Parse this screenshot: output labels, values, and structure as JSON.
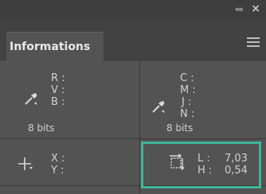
{
  "panel": {
    "collapse_glyph": "««",
    "close_glyph": "×",
    "tab_label": "Informations",
    "menu_icon": "menu-icon"
  },
  "left_color": {
    "r_label": "R :",
    "v_label": "V :",
    "b_label": "B :",
    "bits": "8 bits"
  },
  "right_color": {
    "c_label": "C :",
    "m_label": "M :",
    "j_label": "J :",
    "n_label": "N :",
    "bits": "8 bits"
  },
  "position": {
    "x_label": "X :",
    "y_label": "Y :"
  },
  "size": {
    "l_label": "L :",
    "l_value": "7,03",
    "h_label": "H :",
    "h_value": "0,54"
  },
  "colors": {
    "highlight": "#3fb59a"
  }
}
